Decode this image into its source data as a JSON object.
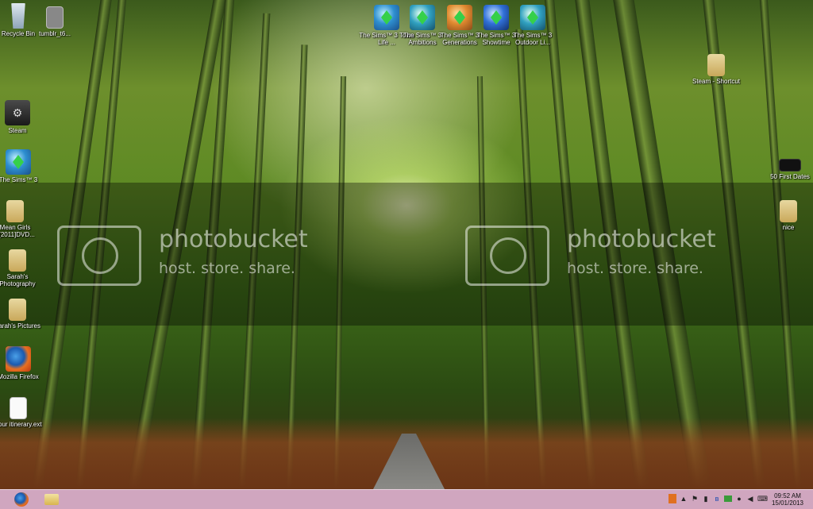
{
  "watermark": {
    "brand": "photobucket",
    "tagline": "host. store. share."
  },
  "desktop_icons": {
    "recycle_bin": "Recycle Bin",
    "tumblr": "tumblr_t6...",
    "steam": "Steam",
    "sims3": "The Sims™ 3",
    "mean_girls": "Mean Girls 2[2011]DVD...",
    "sarahs_photography": "Sarah's Photography",
    "sarahs_pictures": "Sarah's Pictures",
    "firefox": "Mozilla Firefox",
    "itinerary": "Your itinerary.ext",
    "sims_town_life": "The Sims™ 3 Town Life ...",
    "sims_ambitions": "The Sims™ 3 Ambitions",
    "sims_generations": "The Sims™ 3 Generations",
    "sims_showtime": "The Sims™ 3 Showtime",
    "sims_outdoor": "The Sims™ 3 Outdoor Li...",
    "steam_shortcut": "Steam - Shortcut",
    "fifty_first_dates": "50 First Dates",
    "nice": "nice"
  },
  "taskbar": {
    "time": "09:52 AM",
    "date": "15/01/2013",
    "pinned": [
      "firefox-icon",
      "file-explorer-icon"
    ],
    "tray_icons": [
      "app-icon",
      "network-icon",
      "flag-icon",
      "speaker-icon",
      "bluetooth-icon",
      "battery-icon",
      "steam-tray-icon",
      "volume-icon",
      "language-icon"
    ]
  }
}
